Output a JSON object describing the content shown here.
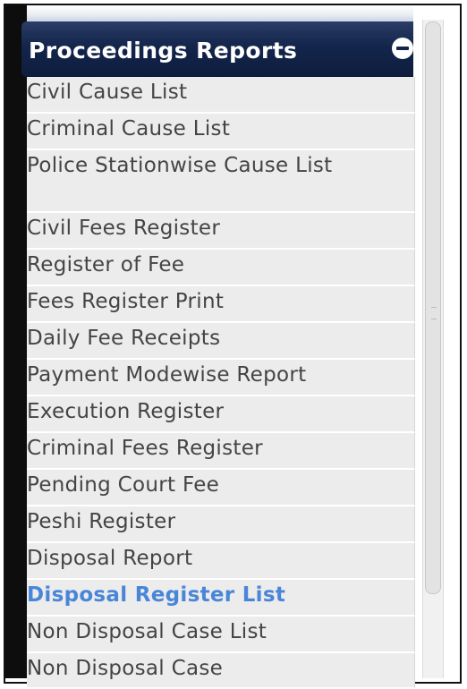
{
  "header": {
    "title": "Proceedings Reports",
    "collapse_icon": "minus-circle-icon"
  },
  "menu": {
    "items": [
      {
        "label": "Civil Cause List"
      },
      {
        "label": "Criminal Cause List"
      },
      {
        "label": "Police Stationwise Cause List"
      },
      {
        "label": "Civil Fees Register"
      },
      {
        "label": "Register of Fee"
      },
      {
        "label": "Fees Register Print"
      },
      {
        "label": "Daily Fee Receipts"
      },
      {
        "label": "Payment Modewise Report"
      },
      {
        "label": "Execution Register"
      },
      {
        "label": "Criminal Fees Register"
      },
      {
        "label": "Pending Court Fee"
      },
      {
        "label": "Peshi Register"
      },
      {
        "label": "Disposal Report"
      },
      {
        "label": "Disposal Register List",
        "active": true
      },
      {
        "label": "Non Disposal Case List"
      },
      {
        "label": "Non Disposal Case"
      }
    ]
  },
  "colors": {
    "header_bg": "#13254b",
    "active_text": "#4a86d8",
    "item_bg": "#ececec"
  }
}
